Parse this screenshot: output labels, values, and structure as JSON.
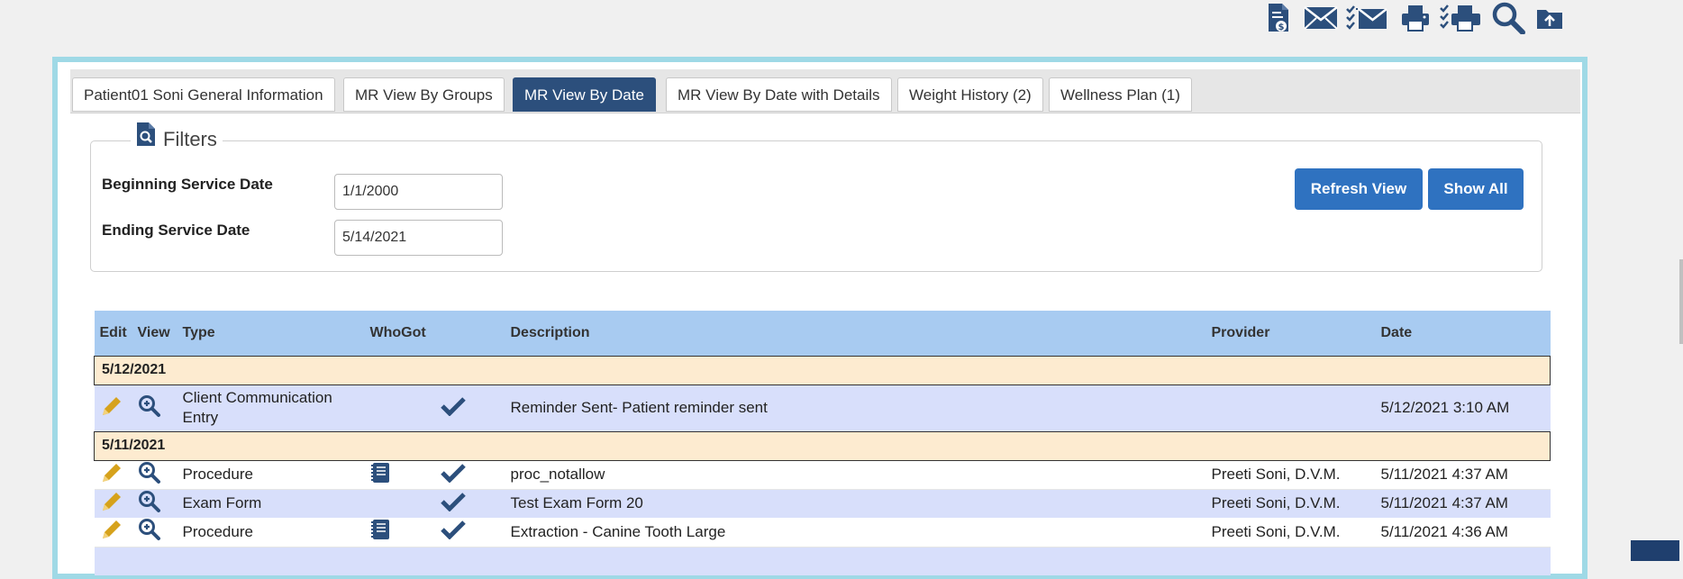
{
  "toolbar": {
    "icons": [
      "invoice-icon",
      "email-icon",
      "checklist-email-icon",
      "print-icon",
      "checklist-print-icon",
      "search-icon",
      "folder-upload-icon"
    ]
  },
  "tabs": [
    {
      "label": "Patient01 Soni General Information",
      "active": false
    },
    {
      "label": "MR View By Groups",
      "active": false
    },
    {
      "label": "MR View By Date",
      "active": true
    },
    {
      "label": "MR View By Date with Details",
      "active": false
    },
    {
      "label": "Weight History (2)",
      "active": false
    },
    {
      "label": "Wellness Plan (1)",
      "active": false
    }
  ],
  "filters": {
    "legend": "Filters",
    "begin_label": "Beginning Service Date",
    "begin_value": "1/1/2000",
    "end_label": "Ending Service Date",
    "end_value": "5/14/2021",
    "refresh_label": "Refresh View",
    "show_all_label": "Show All"
  },
  "table": {
    "headers": {
      "edit": "Edit",
      "view": "View",
      "type": "Type",
      "whogot": "WhoGot",
      "description": "Description",
      "provider": "Provider",
      "date": "Date"
    },
    "groups": [
      {
        "date": "5/12/2021",
        "rows": [
          {
            "type": "Client Communication Entry",
            "notebook": false,
            "checked": true,
            "description": "Reminder Sent- Patient reminder sent",
            "provider": "",
            "date": "5/12/2021 3:10 AM"
          }
        ]
      },
      {
        "date": "5/11/2021",
        "rows": [
          {
            "type": "Procedure",
            "notebook": true,
            "checked": true,
            "description": "proc_notallow",
            "provider": "Preeti Soni, D.V.M.",
            "date": "5/11/2021 4:37 AM"
          },
          {
            "type": "Exam Form",
            "notebook": false,
            "checked": true,
            "description": "Test Exam Form 20",
            "provider": "Preeti Soni, D.V.M.",
            "date": "5/11/2021 4:37 AM"
          },
          {
            "type": "Procedure",
            "notebook": true,
            "checked": true,
            "description": "Extraction - Canine Tooth Large",
            "provider": "Preeti Soni, D.V.M.",
            "date": "5/11/2021 4:36 AM"
          }
        ]
      }
    ]
  },
  "colors": {
    "accent": "#2c4f7c",
    "button": "#2f72c0",
    "header_row": "#a8cbf1",
    "group_row": "#fdebd0",
    "alt_row": "#d8dffb",
    "frame_border": "#9fd9e6",
    "pencil": "#d6a21c",
    "icon_dark": "#2c4f7c"
  }
}
